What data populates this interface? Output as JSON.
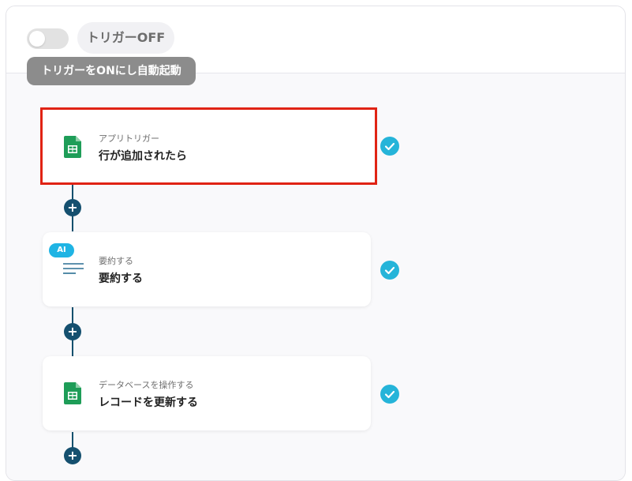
{
  "header": {
    "toggle_state": "off",
    "trigger_label": "トリガーOFF",
    "tooltip": "トリガーをONにし自動起動"
  },
  "steps": [
    {
      "subtitle": "アプリトリガー",
      "title": "行が追加されたら",
      "icon": "google-sheets-icon",
      "status": "completed",
      "selected": true
    },
    {
      "badge": "AI",
      "subtitle": "要約する",
      "title": "要約する",
      "icon": "text-lines-icon",
      "status": "completed",
      "selected": false
    },
    {
      "subtitle": "データベースを操作する",
      "title": "レコードを更新する",
      "icon": "google-sheets-icon",
      "status": "completed",
      "selected": false
    }
  ],
  "add_step_symbol": "+",
  "colors": {
    "selected_border": "#e02314",
    "check": "#25b4d9",
    "connector": "#15506f",
    "ai_badge": "#1fb4e4",
    "sheets_green": "#1e9d58"
  }
}
